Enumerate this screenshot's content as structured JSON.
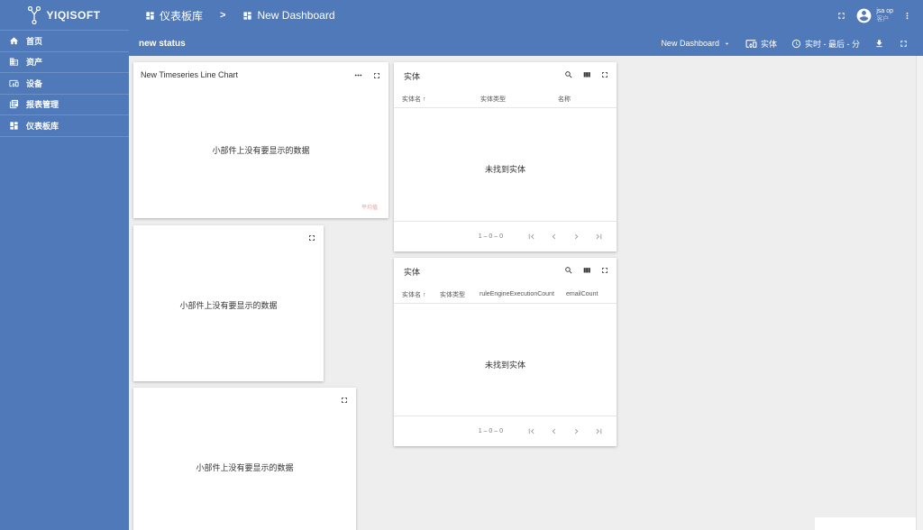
{
  "brand": {
    "name": "YIQISOFT"
  },
  "sidebar": {
    "items": [
      {
        "label": "首页",
        "icon": "home-icon"
      },
      {
        "label": "资产",
        "icon": "asset-icon"
      },
      {
        "label": "设备",
        "icon": "device-icon"
      },
      {
        "label": "报表管理",
        "icon": "report-icon"
      },
      {
        "label": "仪表板库",
        "icon": "dashboard-icon"
      }
    ]
  },
  "breadcrumb": {
    "parent": "仪表板库",
    "separator": ">",
    "current": "New Dashboard"
  },
  "user": {
    "name": "jsa op",
    "role": "客户"
  },
  "dashboard_toolbar": {
    "title": "new status",
    "dashboard_select": "New Dashboard",
    "entities_label": "实体",
    "timewindow_label": "实时 - 最后 - 分"
  },
  "widgets": {
    "timeseries": {
      "title": "New Timeseries Line Chart",
      "empty": "小部件上没有要显示的数据",
      "legend": "平均值"
    },
    "empty_widget_1": {
      "empty": "小部件上没有要显示的数据"
    },
    "empty_widget_2": {
      "empty": "小部件上没有要显示的数据"
    },
    "entities_1": {
      "title": "实体",
      "columns": [
        "实体名 ↑",
        "实体类型",
        "名称"
      ],
      "empty": "未找到实体",
      "pagination": "1 – 0 – 0"
    },
    "entities_2": {
      "title": "实体",
      "columns": [
        "实体名 ↑",
        "实体类型",
        "ruleEngineExecutionCount",
        "emailCount"
      ],
      "empty": "未找到实体",
      "pagination": "1 – 0 – 0"
    }
  },
  "colors": {
    "primary": "#4f79b8",
    "background": "#eeeeee"
  }
}
